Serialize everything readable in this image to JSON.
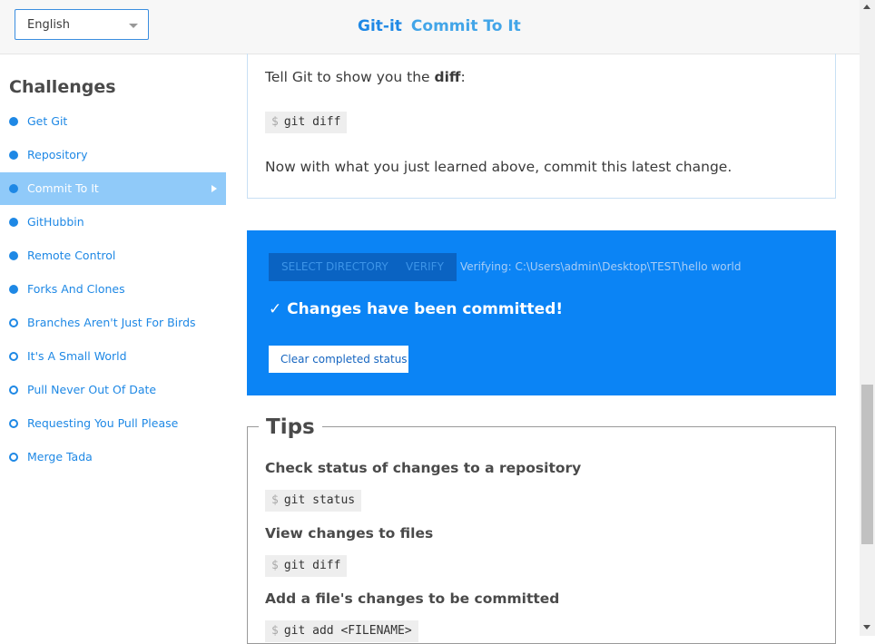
{
  "header": {
    "language": "English",
    "app_name": "Git-it",
    "challenge_title": "Commit To It"
  },
  "sidebar": {
    "heading": "Challenges",
    "items": [
      {
        "label": "Get Git",
        "completed": true
      },
      {
        "label": "Repository",
        "completed": true
      },
      {
        "label": "Commit To It",
        "completed": true,
        "active": true
      },
      {
        "label": "GitHubbin",
        "completed": true
      },
      {
        "label": "Remote Control",
        "completed": true
      },
      {
        "label": "Forks And Clones",
        "completed": true
      },
      {
        "label": "Branches Aren't Just For Birds",
        "completed": false
      },
      {
        "label": "It's A Small World",
        "completed": false
      },
      {
        "label": "Pull Never Out Of Date",
        "completed": false
      },
      {
        "label": "Requesting You Pull Please",
        "completed": false
      },
      {
        "label": "Merge Tada",
        "completed": false
      }
    ]
  },
  "main": {
    "diff_text_pre": "Tell Git to show you the ",
    "diff_text_bold": "diff",
    "diff_text_post": ":",
    "diff_command": "git diff",
    "commit_text": "Now with what you just learned above, commit this latest change.",
    "prompt_symbol": "$"
  },
  "verify": {
    "select_dir_label": "SELECT DIRECTORY",
    "verify_label": "VERIFY",
    "verifying_text": "Verifying: C:\\Users\\admin\\Desktop\\TEST\\hello world",
    "committed_message": "✓ Changes have been committed!",
    "clear_label": "Clear completed status"
  },
  "tips": {
    "heading": "Tips",
    "items": [
      {
        "title": "Check status of changes to a repository",
        "command": "git status"
      },
      {
        "title": "View changes to files",
        "command": "git diff"
      },
      {
        "title": "Add a file's changes to be committed",
        "command": "git add <FILENAME>"
      }
    ]
  },
  "colors": {
    "accent": "#1e88e5",
    "active_item_bg": "#90caf9",
    "verify_bg": "#0b84f5"
  }
}
